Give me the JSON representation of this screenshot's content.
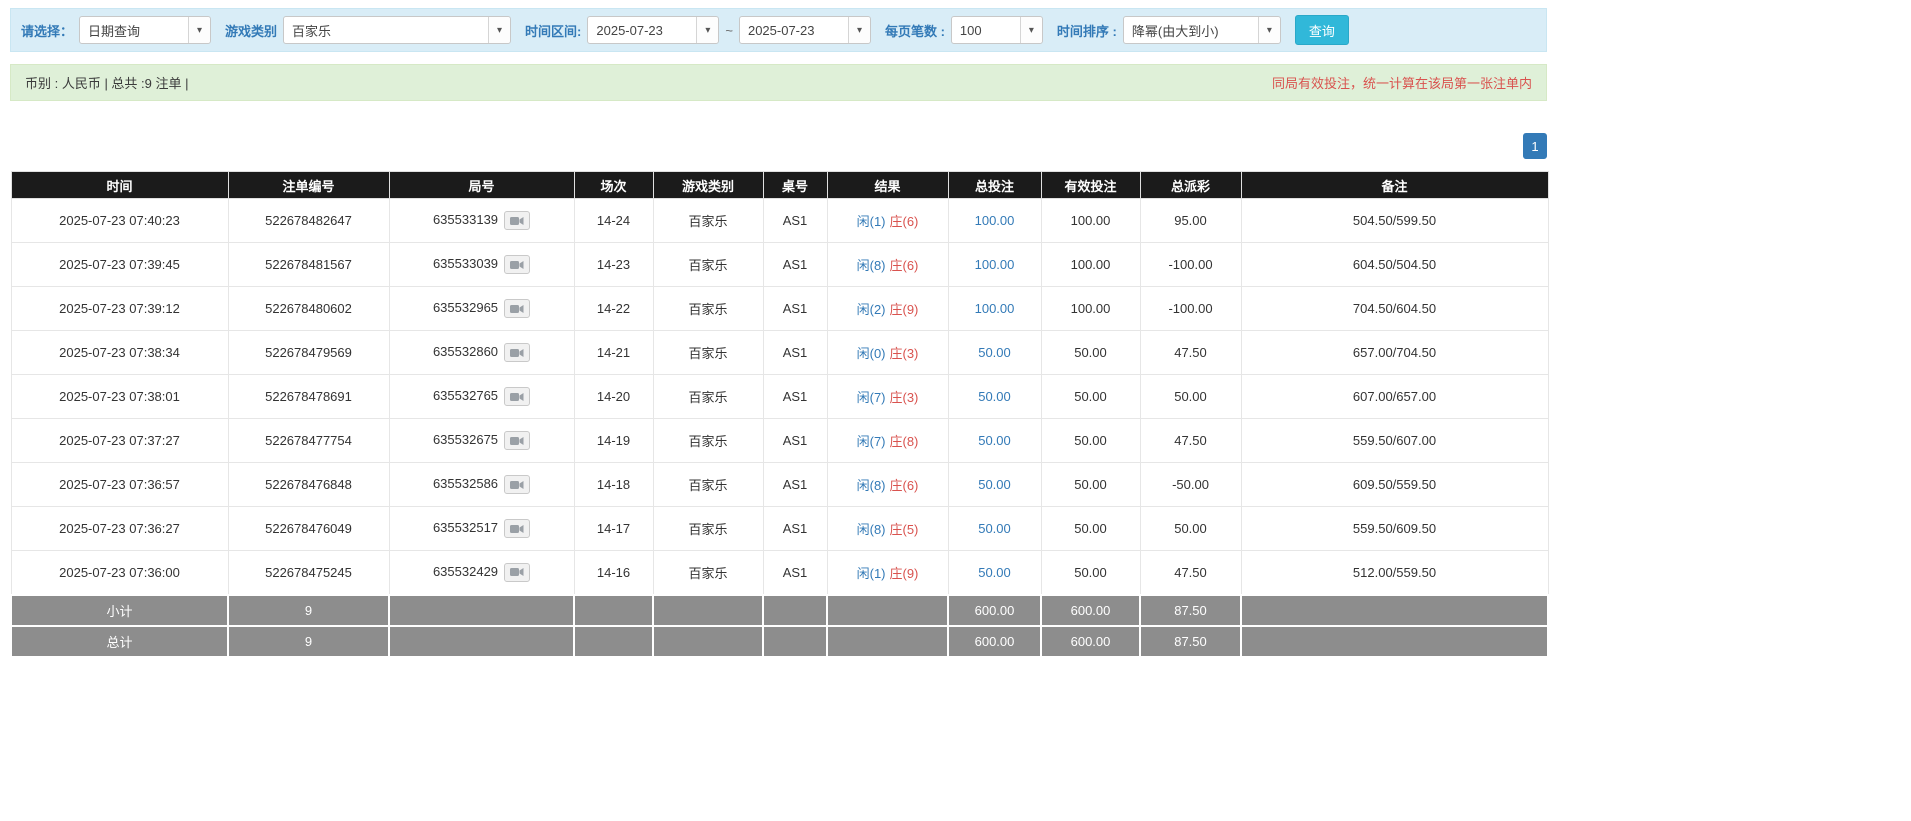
{
  "colors": {
    "accent_blue": "#337ab7",
    "negative_red": "#e4393c",
    "banker_red": "#d9534f",
    "search_button_cyan": "#31b8d9",
    "filter_bar_bg": "#d9edf7",
    "status_bar_bg": "#dff0d8",
    "table_header_bg": "#1b1b1b",
    "summary_row_bg": "#8d8d8d"
  },
  "filters": {
    "select_label": "请选择：",
    "select_value": "日期查询",
    "game_type_label": "游戏类别",
    "game_type_value": "百家乐",
    "date_range_label": "时间区间:",
    "date_from": "2025-07-23",
    "tilde": "~",
    "date_to": "2025-07-23",
    "page_size_label": "每页笔数 :",
    "page_size_value": "100",
    "sort_label": "时间排序 :",
    "sort_value": "降幂(由大到小)",
    "search_button": "查询"
  },
  "status": {
    "left": "币别 : 人民币 | 总共 :9 注单 |",
    "right": "同局有效投注，统一计算在该局第一张注单内"
  },
  "pagination": {
    "page": "1"
  },
  "table": {
    "headers": [
      "时间",
      "注单编号",
      "局号",
      "场次",
      "游戏类别",
      "桌号",
      "结果",
      "总投注",
      "有效投注",
      "总派彩",
      "备注"
    ],
    "rows": [
      {
        "time": "2025-07-23 07:40:23",
        "bet_id": "522678482647",
        "round": "635533139",
        "session": "14-24",
        "game": "百家乐",
        "table_no": "AS1",
        "player": "闲(1)",
        "banker": "庄(6)",
        "total_bet": "100.00",
        "valid_bet": "100.00",
        "payout": "95.00",
        "note": "504.50/599.50"
      },
      {
        "time": "2025-07-23 07:39:45",
        "bet_id": "522678481567",
        "round": "635533039",
        "session": "14-23",
        "game": "百家乐",
        "table_no": "AS1",
        "player": "闲(8)",
        "banker": "庄(6)",
        "total_bet": "100.00",
        "valid_bet": "100.00",
        "payout": "-100.00",
        "note": "604.50/504.50"
      },
      {
        "time": "2025-07-23 07:39:12",
        "bet_id": "522678480602",
        "round": "635532965",
        "session": "14-22",
        "game": "百家乐",
        "table_no": "AS1",
        "player": "闲(2)",
        "banker": "庄(9)",
        "total_bet": "100.00",
        "valid_bet": "100.00",
        "payout": "-100.00",
        "note": "704.50/604.50"
      },
      {
        "time": "2025-07-23 07:38:34",
        "bet_id": "522678479569",
        "round": "635532860",
        "session": "14-21",
        "game": "百家乐",
        "table_no": "AS1",
        "player": "闲(0)",
        "banker": "庄(3)",
        "total_bet": "50.00",
        "valid_bet": "50.00",
        "payout": "47.50",
        "note": "657.00/704.50"
      },
      {
        "time": "2025-07-23 07:38:01",
        "bet_id": "522678478691",
        "round": "635532765",
        "session": "14-20",
        "game": "百家乐",
        "table_no": "AS1",
        "player": "闲(7)",
        "banker": "庄(3)",
        "total_bet": "50.00",
        "valid_bet": "50.00",
        "payout": "50.00",
        "note": "607.00/657.00"
      },
      {
        "time": "2025-07-23 07:37:27",
        "bet_id": "522678477754",
        "round": "635532675",
        "session": "14-19",
        "game": "百家乐",
        "table_no": "AS1",
        "player": "闲(7)",
        "banker": "庄(8)",
        "total_bet": "50.00",
        "valid_bet": "50.00",
        "payout": "47.50",
        "note": "559.50/607.00"
      },
      {
        "time": "2025-07-23 07:36:57",
        "bet_id": "522678476848",
        "round": "635532586",
        "session": "14-18",
        "game": "百家乐",
        "table_no": "AS1",
        "player": "闲(8)",
        "banker": "庄(6)",
        "total_bet": "50.00",
        "valid_bet": "50.00",
        "payout": "-50.00",
        "note": "609.50/559.50"
      },
      {
        "time": "2025-07-23 07:36:27",
        "bet_id": "522678476049",
        "round": "635532517",
        "session": "14-17",
        "game": "百家乐",
        "table_no": "AS1",
        "player": "闲(8)",
        "banker": "庄(5)",
        "total_bet": "50.00",
        "valid_bet": "50.00",
        "payout": "50.00",
        "note": "559.50/609.50"
      },
      {
        "time": "2025-07-23 07:36:00",
        "bet_id": "522678475245",
        "round": "635532429",
        "session": "14-16",
        "game": "百家乐",
        "table_no": "AS1",
        "player": "闲(1)",
        "banker": "庄(9)",
        "total_bet": "50.00",
        "valid_bet": "50.00",
        "payout": "47.50",
        "note": "512.00/559.50"
      }
    ],
    "subtotal": {
      "label": "小计",
      "count": "9",
      "total_bet": "600.00",
      "valid_bet": "600.00",
      "payout": "87.50"
    },
    "total": {
      "label": "总计",
      "count": "9",
      "total_bet": "600.00",
      "valid_bet": "600.00",
      "payout": "87.50"
    }
  }
}
